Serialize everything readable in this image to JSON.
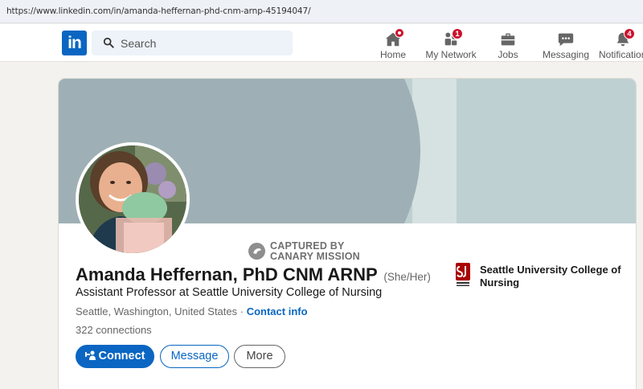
{
  "browser": {
    "url": "https://www.linkedin.com/in/amanda-heffernan-phd-cnm-arnp-45194047/"
  },
  "nav": {
    "logo": "in",
    "search_placeholder": "Search",
    "items": [
      {
        "label": "Home",
        "icon": "home-icon",
        "badge": ""
      },
      {
        "label": "My Network",
        "icon": "people-icon",
        "badge": "1"
      },
      {
        "label": "Jobs",
        "icon": "briefcase-icon",
        "badge": ""
      },
      {
        "label": "Messaging",
        "icon": "chat-icon",
        "badge": ""
      },
      {
        "label": "Notifications",
        "icon": "bell-icon",
        "badge": "4"
      }
    ]
  },
  "watermark": {
    "line1": "CAPTURED BY",
    "line2": "CANARY MISSION"
  },
  "profile": {
    "name": "Amanda Heffernan, PhD CNM ARNP",
    "pronouns": "(She/Her)",
    "headline": "Assistant Professor at Seattle University College of Nursing",
    "location": "Seattle, Washington, United States",
    "separator": " · ",
    "contact_info": "Contact info",
    "connections": "322 connections"
  },
  "actions": {
    "connect": "Connect",
    "message": "Message",
    "more": "More"
  },
  "organization": {
    "name": "Seattle University College of Nursing"
  },
  "colors": {
    "linkedin_blue": "#0a66c2",
    "badge_red": "#cb112d",
    "banner_left": "#9eb0b5",
    "banner_right": "#bfd0d2"
  }
}
